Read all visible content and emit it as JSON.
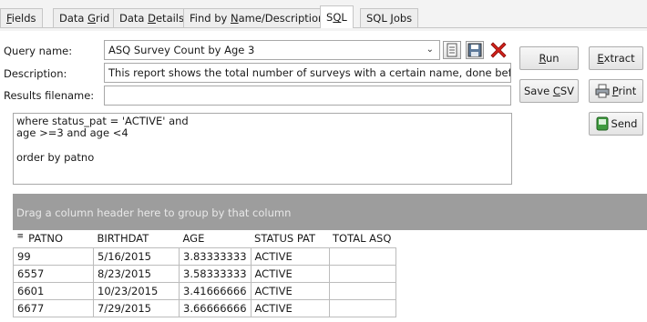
{
  "tabs": [
    {
      "pre": "",
      "key": "F",
      "post": "ields"
    },
    {
      "pre": "Data ",
      "key": "G",
      "post": "rid"
    },
    {
      "pre": "Data ",
      "key": "D",
      "post": "etails"
    },
    {
      "pre": "Find by ",
      "key": "N",
      "post": "ame/Description"
    },
    {
      "pre": "S",
      "key": "Q",
      "post": "L"
    },
    {
      "pre": "SQL ",
      "key": "J",
      "post": "obs"
    }
  ],
  "form": {
    "query_name_label": "Query name:",
    "query_name_value": "ASQ Survey Count by Age 3",
    "description_label": "Description:",
    "description_value": "This report shows the total number of surveys with a certain name, done before a",
    "results_label": "Results filename:",
    "results_value": ""
  },
  "buttons": {
    "run": {
      "pre": "",
      "key": "R",
      "post": "un"
    },
    "extract": {
      "pre": "",
      "key": "E",
      "post": "xtract"
    },
    "save_csv": {
      "pre": "Save ",
      "key": "C",
      "post": "SV"
    },
    "print": {
      "pre": "",
      "key": "P",
      "post": "rint"
    },
    "send": "Send"
  },
  "sql_text": "where status_pat = 'ACTIVE' and\nage >=3 and age <4\n\norder by patno",
  "grid": {
    "group_hint": "Drag a column header here to group by that column",
    "columns": [
      "PATNO",
      "BIRTHDAT",
      "AGE",
      "STATUS PAT",
      "TOTAL ASQ"
    ],
    "rows": [
      [
        "99",
        "5/16/2015",
        "3.83333333",
        "ACTIVE",
        ""
      ],
      [
        "6557",
        "8/23/2015",
        "3.58333333",
        "ACTIVE",
        ""
      ],
      [
        "6601",
        "10/23/2015",
        "3.41666666",
        "ACTIVE",
        ""
      ],
      [
        "6677",
        "7/29/2015",
        "3.66666666",
        "ACTIVE",
        ""
      ]
    ]
  },
  "icons": {
    "toolbar": [
      "document-icon",
      "save-icon",
      "delete-icon"
    ],
    "print": "printer-icon",
    "send": "send-icon",
    "column_chooser": "column-chooser-icon"
  },
  "colors": {
    "group_bar": "#9d9d9d",
    "delete_icon": "#d0201a"
  }
}
